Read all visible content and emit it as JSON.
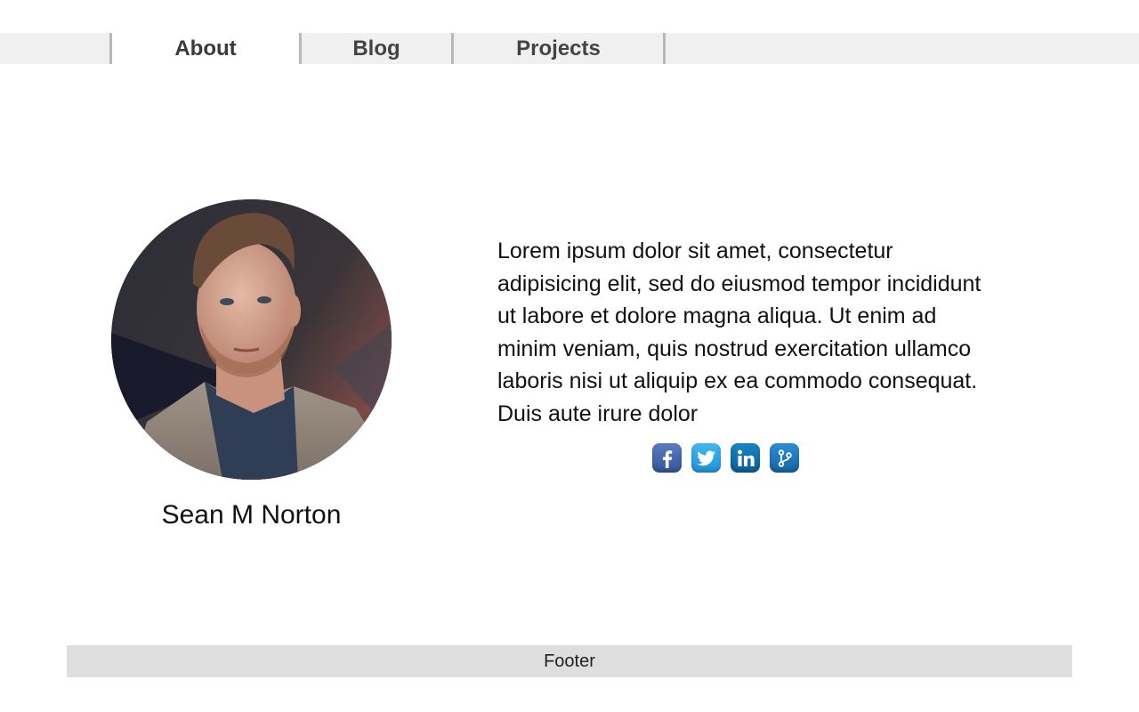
{
  "nav": {
    "tabs": [
      {
        "label": "About",
        "active": true
      },
      {
        "label": "Blog",
        "active": false
      },
      {
        "label": "Projects",
        "active": false
      }
    ]
  },
  "profile": {
    "name": "Sean M Norton"
  },
  "bio": {
    "text": "Lorem ipsum dolor sit amet, consectetur adipisicing elit, sed do eiusmod tempor incididunt ut labore et dolore magna aliqua. Ut enim ad minim veniam, quis nostrud exercitation ullamco laboris nisi ut aliquip ex ea commodo consequat. Duis aute irure dolor"
  },
  "social": [
    {
      "icon": "facebook-icon",
      "color": "#3b5998"
    },
    {
      "icon": "twitter-icon",
      "color": "#1da1f2"
    },
    {
      "icon": "linkedin-icon",
      "color": "#0e76a8"
    },
    {
      "icon": "git-icon",
      "color": "#1a73b8"
    }
  ],
  "footer": {
    "text": "Footer"
  }
}
